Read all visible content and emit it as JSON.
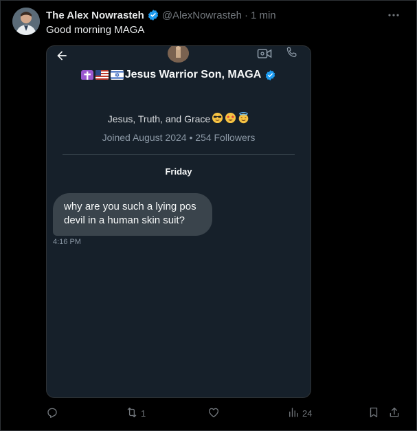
{
  "tweet": {
    "author_name": "The Alex Nowrasteh",
    "handle": "@AlexNowrasteh",
    "separator": "·",
    "time": "1 min",
    "text": "Good morning MAGA"
  },
  "dm_card": {
    "display_name": "Jesus Warrior Son, MAGA",
    "bio": "Jesus, Truth, and Grace",
    "meta": "Joined August 2024 • 254 Followers",
    "day_label": "Friday",
    "message_text": "why are you such a lying pos devil in a human skin suit?",
    "message_time": "4:16 PM",
    "icons": [
      "back-arrow-icon",
      "video-icon",
      "phone-icon"
    ]
  },
  "actions": {
    "reply_count": "",
    "retweet_count": "1",
    "like_count": "",
    "views_count": "24"
  },
  "colors": {
    "background": "#000000",
    "card": "#16202a",
    "bubble": "#3a444c",
    "verified": "#1d9bf0",
    "muted": "#71767b"
  }
}
